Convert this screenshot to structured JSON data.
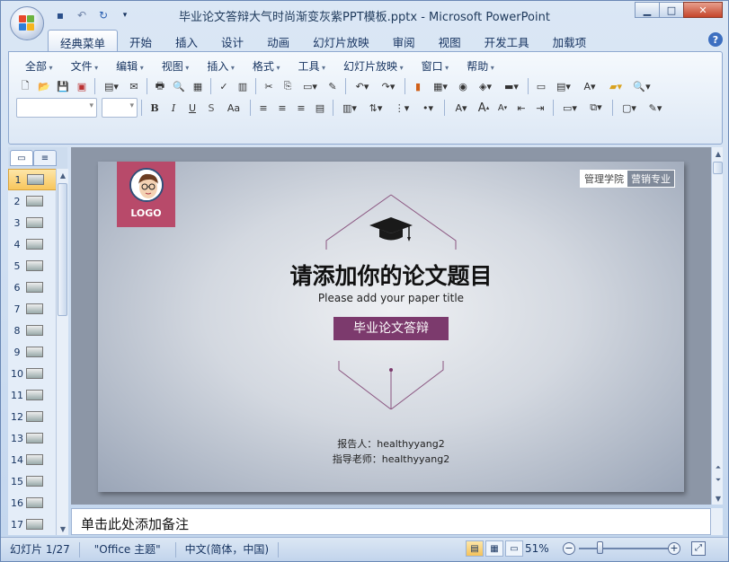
{
  "window": {
    "title": "毕业论文答辩大气时尚渐变灰紫PPT模板.pptx - Microsoft PowerPoint",
    "minimize": "▁",
    "maximize": "□",
    "close": "✕"
  },
  "qat": [
    "save-icon",
    "undo-icon",
    "redo-icon",
    "customize-icon"
  ],
  "ribbon_tabs": [
    "经典菜单",
    "开始",
    "插入",
    "设计",
    "动画",
    "幻灯片放映",
    "审阅",
    "视图",
    "开发工具",
    "加载项"
  ],
  "active_tab": "经典菜单",
  "help_label": "?",
  "menus": [
    "全部",
    "文件",
    "编辑",
    "视图",
    "插入",
    "格式",
    "工具",
    "幻灯片放映",
    "窗口",
    "帮助"
  ],
  "toolbar": {
    "new": "🗋",
    "open": "📂",
    "save": "💾",
    "print": "🖶",
    "preview": "🔍",
    "cut": "✂",
    "copy": "⎘",
    "paste": "📋",
    "undo": "↶",
    "redo": "↷",
    "bold": "B",
    "italic": "I",
    "underline": "U",
    "shadow": "S",
    "case": "Aa",
    "grow": "A",
    "shrink": "A",
    "textbox": "A",
    "find": "🔍"
  },
  "thumbnails": [
    {
      "n": "1"
    },
    {
      "n": "2"
    },
    {
      "n": "3"
    },
    {
      "n": "4"
    },
    {
      "n": "5"
    },
    {
      "n": "6"
    },
    {
      "n": "7"
    },
    {
      "n": "8"
    },
    {
      "n": "9"
    },
    {
      "n": "10"
    },
    {
      "n": "11"
    },
    {
      "n": "12"
    },
    {
      "n": "13"
    },
    {
      "n": "14"
    },
    {
      "n": "15"
    },
    {
      "n": "16"
    },
    {
      "n": "17"
    }
  ],
  "slide": {
    "logo": "LOGO",
    "badge_left": "管理学院",
    "badge_right": "营销专业",
    "title": "请添加你的论文题目",
    "subtitle": "Please add your paper title",
    "band": "毕业论文答辩",
    "reporter": "报告人：healthyyang2",
    "advisor": "指导老师：healthyyang2"
  },
  "notes_placeholder": "单击此处添加备注",
  "status": {
    "slide_count": "幻灯片 1/27",
    "theme": "\"Office 主题\"",
    "language": "中文(简体，中国)",
    "zoom": "51%",
    "zoom_level": 0.51
  },
  "colors": {
    "accent_purple": "#7c3a6d",
    "logo_pink": "#b84a6a",
    "ribbon_blue": "#c3d6ee"
  }
}
